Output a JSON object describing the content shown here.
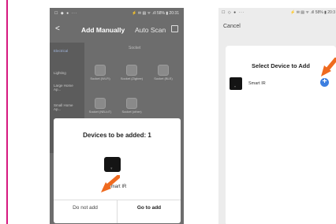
{
  "screen1": {
    "status_left": "☐ ◆ ● ···",
    "status_right": "⚡ ✉ ▤ ᯤ .ıll 58% ▮ 20:31",
    "title": "Add Manually",
    "auto_scan": "Auto Scan",
    "section_label": "Socket",
    "categories": [
      "Electrical",
      "Lighting",
      "Large Home Ap...",
      "Small Home Ap..."
    ],
    "devices": [
      {
        "label": "Socket (Wi-Fi)"
      },
      {
        "label": "Socket (Zigbee)"
      },
      {
        "label": "Socket (BLE)"
      },
      {
        "label": "Socket (NB-IoT)"
      },
      {
        "label": "Socket (other)"
      }
    ],
    "sheet": {
      "title": "Devices to be added: 1",
      "device_name": "Smart IR",
      "cancel_label": "Do not add",
      "confirm_label": "Go to add"
    }
  },
  "screen2": {
    "status_left": "☐ ◇ ● ···",
    "status_right": "⚡ ✉ ▤ ᯤ .ıll 58% ▮ 20:3",
    "cancel_label": "Cancel",
    "card_title": "Select Device to Add",
    "device_name": "Smart IR"
  },
  "colors": {
    "accent_bar": "#d6187f",
    "arrow": "#ef6a1f",
    "add_button": "#3d7fe0"
  }
}
